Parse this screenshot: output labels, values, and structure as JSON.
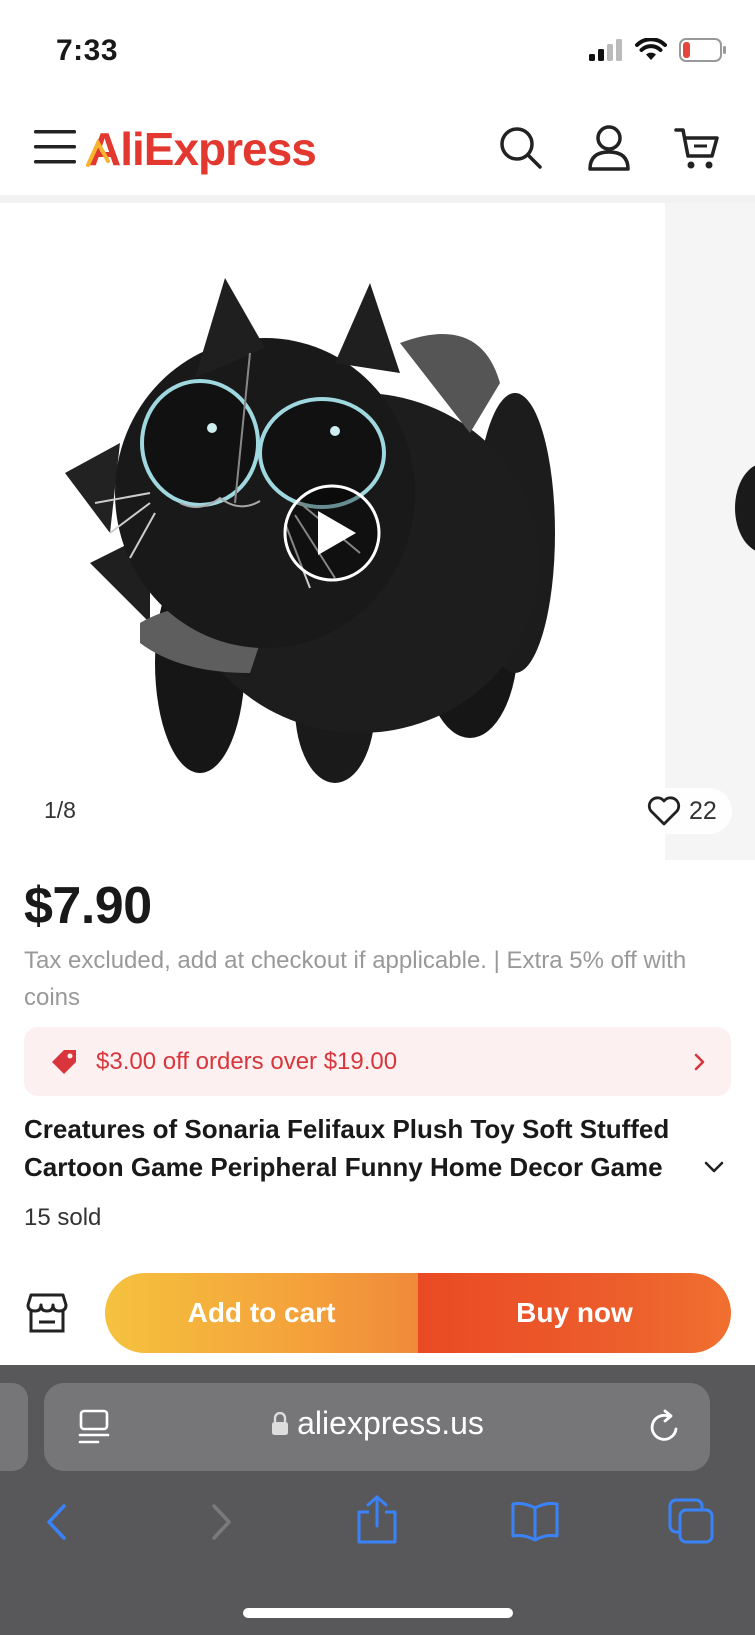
{
  "status_bar": {
    "time": "7:33",
    "battery_color": "#e5463b"
  },
  "header": {
    "logo": "AliExpress",
    "icons": [
      "menu-icon",
      "search-icon",
      "account-icon",
      "cart-icon"
    ],
    "brand_color": "#e3382f"
  },
  "gallery": {
    "counter": "1/8",
    "likes": "22"
  },
  "product": {
    "price": "$7.90",
    "tax_note": "Tax excluded, add at checkout if applicable. | Extra 5% off with coins",
    "coupon": "$3.00 off orders over $19.00",
    "title": "Creatures of Sonaria Felifaux Plush Toy Soft Stuffed Cartoon Game Peripheral Funny Home Decor Game",
    "sold": "15 sold"
  },
  "actions": {
    "add_to_cart": "Add to cart",
    "buy_now": "Buy now"
  },
  "browser": {
    "url": "aliexpress.us",
    "accent": "#3a82f7"
  }
}
